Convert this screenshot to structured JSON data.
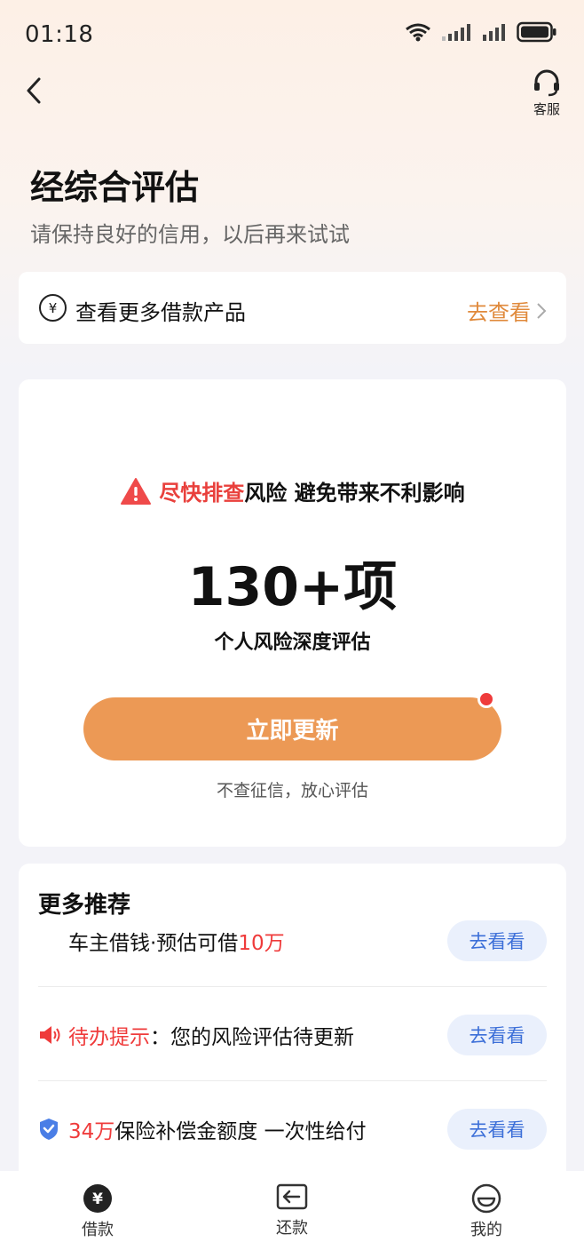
{
  "status_bar": {
    "time": "01:18"
  },
  "nav": {
    "service_label": "客服"
  },
  "header": {
    "title": "经综合评估",
    "subtitle": "请保持良好的信用，以后再来试试"
  },
  "more_products": {
    "label": "查看更多借款产品",
    "link_label": "去查看"
  },
  "risk_card": {
    "highlight": "尽快排查",
    "rest": "风险 避免带来不利影响",
    "count": "130+项",
    "count_desc": "个人风险深度评估",
    "cta_label": "立即更新",
    "note": "不查征信，放心评估"
  },
  "recommend": {
    "title": "更多推荐",
    "rows": [
      {
        "prefix": "车主借钱·预估可借",
        "highlight": "10万",
        "suffix": "",
        "button": "去看看"
      },
      {
        "prefix": "",
        "highlight": "待办提示",
        "suffix": "：您的风险评估待更新",
        "button": "去看看"
      },
      {
        "prefix": "",
        "highlight": "34万",
        "suffix": "保险补偿金额度 一次性给付",
        "button": "去看看"
      }
    ]
  },
  "tabbar": {
    "tabs": [
      {
        "label": "借款"
      },
      {
        "label": "还款"
      },
      {
        "label": "我的"
      }
    ]
  },
  "colors": {
    "accent_orange": "#ec9955",
    "link_orange": "#e08a3c",
    "alert_red": "#ef3b3b",
    "button_blue": "#3c6fd8"
  }
}
